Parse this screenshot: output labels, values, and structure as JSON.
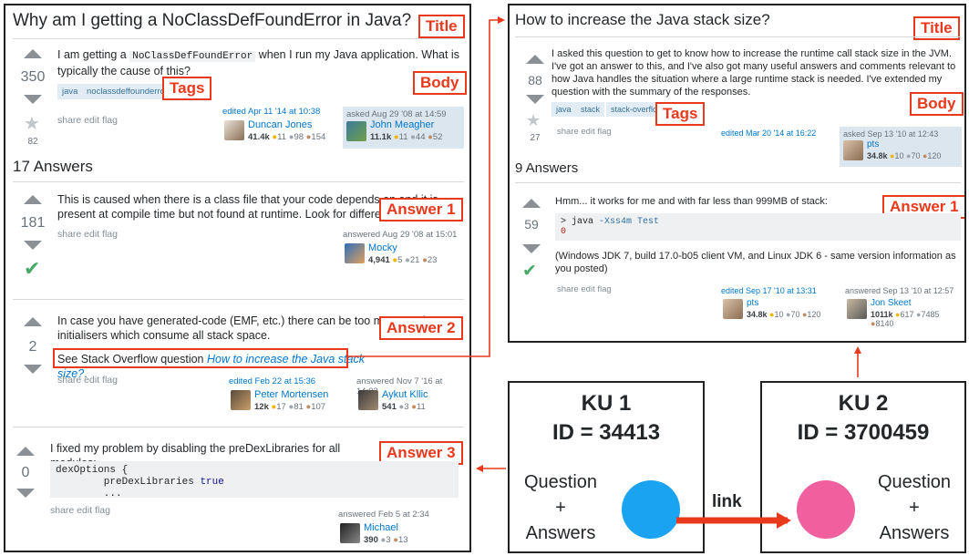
{
  "left": {
    "title": "Why am I getting a NoClassDefFoundError in Java?",
    "labels": {
      "title": "Title",
      "body": "Body",
      "tags": "Tags",
      "answer1": "Answer 1",
      "answer2": "Answer 2",
      "answer3": "Answer 3"
    },
    "question": {
      "votes": "350",
      "favorites": "82",
      "body_pre": "I am getting a ",
      "body_code": "NoClassDefFoundError",
      "body_post": " when I run my Java application. What is typically the cause of this?",
      "tags": [
        "java",
        "noclassdeffounderror"
      ],
      "actions": "share edit flag",
      "edited": {
        "time": "edited Apr 11 '14 at 10:38",
        "user": "Duncan Jones",
        "rep": "41.4k",
        "gold": "11",
        "silver": "98",
        "bronze": "154"
      },
      "asked": {
        "time": "asked Aug 29 '08 at 14:59",
        "user": "John Meagher",
        "rep": "11.1k",
        "gold": "11",
        "silver": "44",
        "bronze": "52"
      }
    },
    "answers_count": "17 Answers",
    "answer1": {
      "votes": "181",
      "text": "This is caused when there is a class file that your code depends on and it is present at compile time but not found at runtime. Look for differences in your build time and runtime classpaths.",
      "actions": "share edit flag",
      "answered": {
        "time": "answered Aug 29 '08 at 15:01",
        "user": "Mocky",
        "rep": "4,941",
        "gold": "5",
        "silver": "21",
        "bronze": "23"
      }
    },
    "answer2": {
      "votes": "2",
      "text": "In case you have generated-code (EMF, etc.) there can be too many static initialisers which consume all stack space.",
      "see_pre": "See Stack Overflow question ",
      "see_link": "How to increase the Java stack size?",
      "see_post": ".",
      "actions": "share edit flag",
      "edited": {
        "time": "edited Feb 22 at 15:36",
        "user": "Peter Mortensen",
        "rep": "12k",
        "gold": "17",
        "silver": "81",
        "bronze": "107"
      },
      "answered": {
        "time": "answered Nov 7 '16 at 14:03",
        "user": "Aykut Kllic",
        "rep": "541",
        "silver": "3",
        "bronze": "11"
      }
    },
    "answer3": {
      "votes": "0",
      "text": "I fixed my problem by disabling the preDexLibraries for all modules:",
      "code_l1": "dexOptions {",
      "code_l2a": "        preDexLibraries ",
      "code_l2b": "true",
      "code_l3": "        ...",
      "actions": "share edit flag",
      "answered": {
        "time": "answered Feb 5 at 2:34",
        "user": "Michael",
        "rep": "390",
        "silver": "3",
        "bronze": "13"
      }
    }
  },
  "right": {
    "title": "How to increase the Java stack size?",
    "labels": {
      "title": "Title",
      "body": "Body",
      "tags": "Tags",
      "answer1": "Answer 1"
    },
    "question": {
      "votes": "88",
      "favorites": "27",
      "body": "I asked this question to get to know how to increase the runtime call stack size in the JVM. I've got an answer to this, and I've also got many useful answers and comments relevant to how Java handles the situation where a large runtime stack is needed. I've extended my question with the summary of the responses.",
      "tags": [
        "java",
        "stack",
        "stack-overflow"
      ],
      "actions": "share edit flag",
      "edited": {
        "time": "edited Mar 20 '14 at 16:22"
      },
      "asked": {
        "time": "asked Sep 13 '10 at 12:43",
        "user": "pts",
        "rep": "34.8k",
        "gold": "10",
        "silver": "70",
        "bronze": "120"
      }
    },
    "answers_count": "9 Answers",
    "answer1": {
      "votes": "59",
      "text": "Hmm... it works for me and with far less than 999MB of stack:",
      "code_l1a": "> java ",
      "code_l1b": "-Xss4m Test",
      "code_l2": "0",
      "text2": "(Windows JDK 7, build 17.0-b05 client VM, and Linux JDK 6 - same version information as you posted)",
      "actions": "share edit flag",
      "edited": {
        "time": "edited Sep 17 '10 at 13:31",
        "user": "pts",
        "rep": "34.8k",
        "gold": "10",
        "silver": "70",
        "bronze": "120"
      },
      "answered": {
        "time": "answered Sep 13 '10 at 12:57",
        "user": "Jon Skeet",
        "rep": "1011k",
        "gold": "617",
        "silver": "7485",
        "bronze": "8140"
      }
    }
  },
  "ku1": {
    "title": "KU 1",
    "id": "ID = 34413",
    "question": "Question",
    "plus": "+",
    "answers": "Answers",
    "color": "#1aa3f0"
  },
  "ku2": {
    "title": "KU 2",
    "id": "ID = 3700459",
    "question": "Question",
    "plus": "+",
    "answers": "Answers",
    "color": "#f0609e"
  },
  "link_label": "link",
  "accent_red": "#e8391d",
  "dots": "●"
}
